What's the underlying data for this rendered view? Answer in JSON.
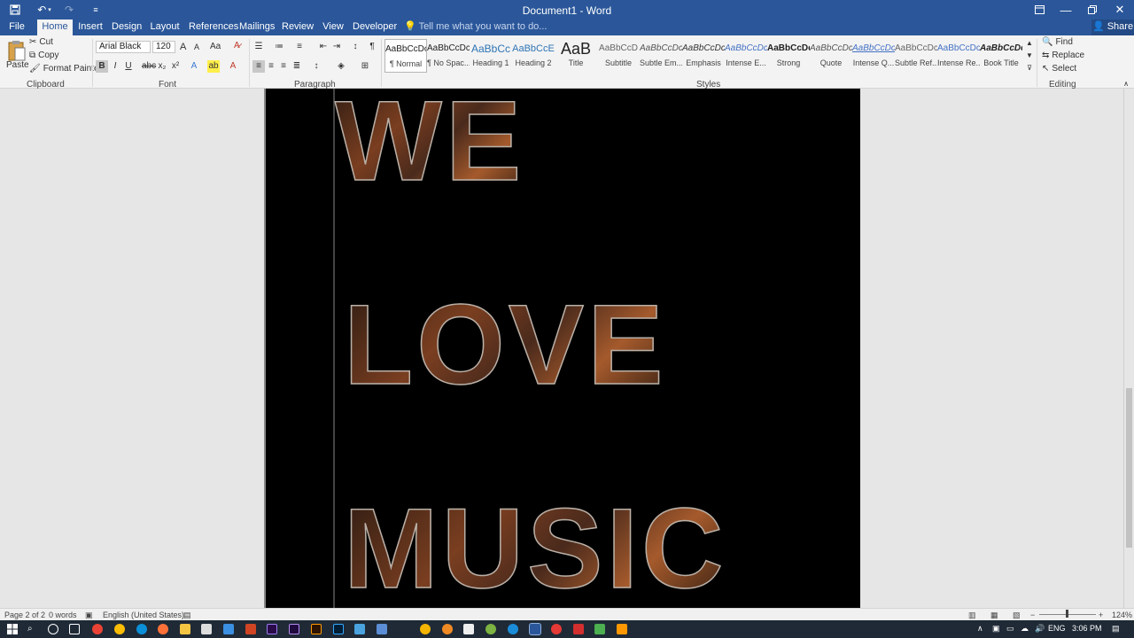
{
  "window": {
    "title": "Document1 - Word",
    "share_label": "Share",
    "tell_me_placeholder": "Tell me what you want to do..."
  },
  "tabs": [
    "File",
    "Home",
    "Insert",
    "Design",
    "Layout",
    "References",
    "Mailings",
    "Review",
    "View",
    "Developer"
  ],
  "active_tab": "Home",
  "ribbon": {
    "clipboard": {
      "paste": "Paste",
      "cut": "Cut",
      "copy": "Copy",
      "format_painter": "Format Painter",
      "label": "Clipboard"
    },
    "font": {
      "name": "Arial Black",
      "size": "120",
      "label": "Font",
      "change_case": "Aa",
      "grow": "A",
      "shrink": "A"
    },
    "paragraph": {
      "label": "Paragraph"
    },
    "styles": {
      "label": "Styles",
      "items": [
        {
          "sample": "AaBbCcDc",
          "name": "¶ Normal"
        },
        {
          "sample": "AaBbCcDc",
          "name": "¶ No Spac..."
        },
        {
          "sample": "AaBbCc",
          "name": "Heading 1"
        },
        {
          "sample": "AaBbCcE",
          "name": "Heading 2"
        },
        {
          "sample": "AaB",
          "name": "Title"
        },
        {
          "sample": "AaBbCcD",
          "name": "Subtitle"
        },
        {
          "sample": "AaBbCcDc",
          "name": "Subtle Em..."
        },
        {
          "sample": "AaBbCcDc",
          "name": "Emphasis"
        },
        {
          "sample": "AaBbCcDc",
          "name": "Intense E..."
        },
        {
          "sample": "AaBbCcDc",
          "name": "Strong"
        },
        {
          "sample": "AaBbCcDc",
          "name": "Quote"
        },
        {
          "sample": "AaBbCcDc",
          "name": "Intense Q..."
        },
        {
          "sample": "AaBbCcDc",
          "name": "Subtle Ref..."
        },
        {
          "sample": "AaBbCcDc",
          "name": "Intense Re..."
        },
        {
          "sample": "AaBbCcDc",
          "name": "Book Title"
        }
      ]
    },
    "editing": {
      "find": "Find",
      "replace": "Replace",
      "select": "Select",
      "label": "Editing"
    }
  },
  "document": {
    "lines": [
      "WE",
      "LOVE",
      "MUSIC"
    ]
  },
  "status": {
    "page": "Page 2 of 2",
    "words": "0 words",
    "language": "English (United States)",
    "zoom": "124%"
  },
  "taskbar": {
    "language": "ENG",
    "time": "3:06 PM"
  }
}
